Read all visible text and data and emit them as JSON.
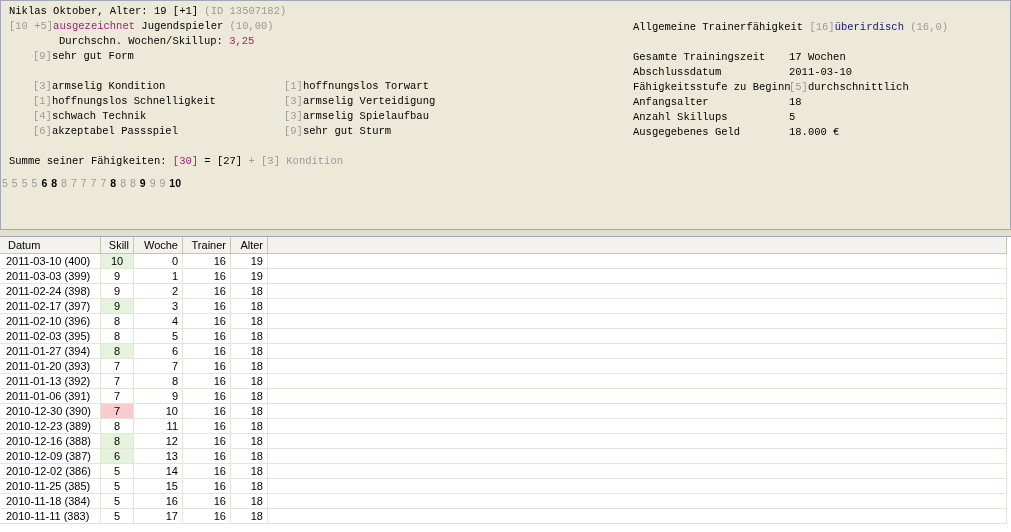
{
  "player": {
    "segments": [
      {
        "text": "Niklas Oktober, Alter: 19 [+1] ",
        "kind": "normal"
      },
      {
        "text": "(ID 13507182)",
        "kind": "muted"
      }
    ]
  },
  "rating": {
    "segments": [
      {
        "text": "[10 +5]",
        "kind": "muted"
      },
      {
        "text": "ausgezeichnet",
        "kind": "purple"
      },
      {
        "text": " Jugendspieler ",
        "kind": "normal"
      },
      {
        "text": "(10,00)",
        "kind": "muted"
      }
    ]
  },
  "average": {
    "segments": [
      {
        "text": "Durchschn. Wochen/Skillup: ",
        "kind": "normal"
      },
      {
        "text": "3,25",
        "kind": "purple"
      }
    ]
  },
  "form": {
    "segments": [
      {
        "text": "[9]",
        "kind": "muted"
      },
      {
        "text": "sehr gut Form",
        "kind": "normal"
      }
    ]
  },
  "skills": [
    {
      "segments": [
        {
          "text": "[3]",
          "kind": "muted"
        },
        {
          "text": "armselig Kondition",
          "kind": "normal"
        }
      ]
    },
    {
      "segments": [
        {
          "text": "[1]",
          "kind": "muted"
        },
        {
          "text": "hoffnungslos Torwart",
          "kind": "normal"
        }
      ]
    },
    {
      "segments": [
        {
          "text": "[1]",
          "kind": "muted"
        },
        {
          "text": "hoffnungslos Schnelligkeit",
          "kind": "normal"
        }
      ]
    },
    {
      "segments": [
        {
          "text": "[3]",
          "kind": "muted"
        },
        {
          "text": "armselig Verteidigung",
          "kind": "normal"
        }
      ]
    },
    {
      "segments": [
        {
          "text": "[4]",
          "kind": "muted"
        },
        {
          "text": "schwach Technik",
          "kind": "normal"
        }
      ]
    },
    {
      "segments": [
        {
          "text": "[3]",
          "kind": "muted"
        },
        {
          "text": "armselig Spielaufbau",
          "kind": "normal"
        }
      ]
    },
    {
      "segments": [
        {
          "text": "[6]",
          "kind": "muted"
        },
        {
          "text": "akzeptabel Passspiel",
          "kind": "normal"
        }
      ]
    },
    {
      "segments": [
        {
          "text": "[9]",
          "kind": "muted"
        },
        {
          "text": "sehr gut Sturm",
          "kind": "normal"
        }
      ]
    }
  ],
  "sum": {
    "segments": [
      {
        "text": "Summe seiner Fähigkeiten: ",
        "kind": "normal"
      },
      {
        "text": "[30]",
        "kind": "purple"
      },
      {
        "text": " = [27] ",
        "kind": "normal"
      },
      {
        "text": "+ [3] Kondition",
        "kind": "muted"
      }
    ]
  },
  "history": [
    {
      "text": "5",
      "bold": false
    },
    {
      "text": "5",
      "bold": false
    },
    {
      "text": "5",
      "bold": false
    },
    {
      "text": "5",
      "bold": false
    },
    {
      "text": "6",
      "bold": true
    },
    {
      "text": "8",
      "bold": true
    },
    {
      "text": "8",
      "bold": false
    },
    {
      "text": "7",
      "bold": false
    },
    {
      "text": "7",
      "bold": false
    },
    {
      "text": "7",
      "bold": false
    },
    {
      "text": "7",
      "bold": false
    },
    {
      "text": "8",
      "bold": true
    },
    {
      "text": "8",
      "bold": false
    },
    {
      "text": "8",
      "bold": false
    },
    {
      "text": "9",
      "bold": true
    },
    {
      "text": "9",
      "bold": false
    },
    {
      "text": "9",
      "bold": false
    },
    {
      "text": "10",
      "bold": true
    }
  ],
  "trainer": {
    "segments": [
      {
        "text": "Allgemeine Trainerfähigkeit ",
        "kind": "normal"
      },
      {
        "text": "[16]",
        "kind": "muted"
      },
      {
        "text": "überirdisch",
        "kind": "navy"
      },
      {
        "text": " (16,0)",
        "kind": "muted"
      }
    ]
  },
  "stats": [
    {
      "label": "Gesamte Trainingszeit",
      "segments": [
        {
          "text": "17 Wochen",
          "kind": "normal"
        }
      ]
    },
    {
      "label": "Abschlussdatum",
      "segments": [
        {
          "text": "2011-03-10",
          "kind": "normal"
        }
      ]
    },
    {
      "label": "Fähigkeitsstufe zu Beginn",
      "segments": [
        {
          "text": "[5]",
          "kind": "muted"
        },
        {
          "text": "durchschnittlich",
          "kind": "normal"
        }
      ]
    },
    {
      "label": "Anfangsalter",
      "segments": [
        {
          "text": "18",
          "kind": "normal"
        }
      ]
    },
    {
      "label": "Anzahl Skillups",
      "segments": [
        {
          "text": "5",
          "kind": "normal"
        }
      ]
    },
    {
      "label": "Ausgegebenes Geld",
      "segments": [
        {
          "text": "18.000 €",
          "kind": "normal"
        }
      ]
    }
  ],
  "table": {
    "columns": [
      "Datum",
      "Skill",
      "Woche",
      "Trainer",
      "Alter"
    ],
    "rows": [
      {
        "datum": "2011-03-10 (400)",
        "skill": "10",
        "kind": "up",
        "woche": "0",
        "trainer": "16",
        "alter": "19"
      },
      {
        "datum": "2011-03-03 (399)",
        "skill": "9",
        "kind": "none",
        "woche": "1",
        "trainer": "16",
        "alter": "19"
      },
      {
        "datum": "2011-02-24 (398)",
        "skill": "9",
        "kind": "none",
        "woche": "2",
        "trainer": "16",
        "alter": "18"
      },
      {
        "datum": "2011-02-17 (397)",
        "skill": "9",
        "kind": "up",
        "woche": "3",
        "trainer": "16",
        "alter": "18"
      },
      {
        "datum": "2011-02-10 (396)",
        "skill": "8",
        "kind": "none",
        "woche": "4",
        "trainer": "16",
        "alter": "18"
      },
      {
        "datum": "2011-02-03 (395)",
        "skill": "8",
        "kind": "none",
        "woche": "5",
        "trainer": "16",
        "alter": "18"
      },
      {
        "datum": "2011-01-27 (394)",
        "skill": "8",
        "kind": "up",
        "woche": "6",
        "trainer": "16",
        "alter": "18"
      },
      {
        "datum": "2011-01-20 (393)",
        "skill": "7",
        "kind": "none",
        "woche": "7",
        "trainer": "16",
        "alter": "18"
      },
      {
        "datum": "2011-01-13 (392)",
        "skill": "7",
        "kind": "none",
        "woche": "8",
        "trainer": "16",
        "alter": "18"
      },
      {
        "datum": "2011-01-06 (391)",
        "skill": "7",
        "kind": "none",
        "woche": "9",
        "trainer": "16",
        "alter": "18"
      },
      {
        "datum": "2010-12-30 (390)",
        "skill": "7",
        "kind": "down",
        "woche": "10",
        "trainer": "16",
        "alter": "18"
      },
      {
        "datum": "2010-12-23 (389)",
        "skill": "8",
        "kind": "none",
        "woche": "11",
        "trainer": "16",
        "alter": "18"
      },
      {
        "datum": "2010-12-16 (388)",
        "skill": "8",
        "kind": "up",
        "woche": "12",
        "trainer": "16",
        "alter": "18"
      },
      {
        "datum": "2010-12-09 (387)",
        "skill": "6",
        "kind": "up",
        "woche": "13",
        "trainer": "16",
        "alter": "18"
      },
      {
        "datum": "2010-12-02 (386)",
        "skill": "5",
        "kind": "none",
        "woche": "14",
        "trainer": "16",
        "alter": "18"
      },
      {
        "datum": "2010-11-25 (385)",
        "skill": "5",
        "kind": "none",
        "woche": "15",
        "trainer": "16",
        "alter": "18"
      },
      {
        "datum": "2010-11-18 (384)",
        "skill": "5",
        "kind": "none",
        "woche": "16",
        "trainer": "16",
        "alter": "18"
      },
      {
        "datum": "2010-11-11 (383)",
        "skill": "5",
        "kind": "none",
        "woche": "17",
        "trainer": "16",
        "alter": "18"
      }
    ]
  }
}
